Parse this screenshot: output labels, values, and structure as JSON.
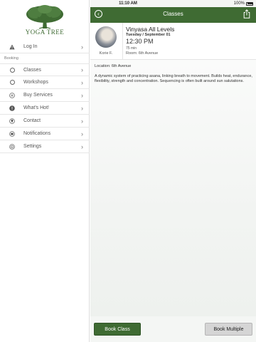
{
  "status_bar": {
    "time": "11:10 AM",
    "battery": "100%"
  },
  "sidebar": {
    "brand": "YOGA TREE",
    "login": {
      "label": "Log In",
      "icon": "warning-icon"
    },
    "section_label": "Booking",
    "items": [
      {
        "label": "Classes",
        "icon": "circle-icon"
      },
      {
        "label": "Workshops",
        "icon": "circle-icon"
      },
      {
        "label": "Buy Services",
        "icon": "plus-circle-icon"
      },
      {
        "label": "What's Hot!",
        "icon": "exclamation-circle-icon"
      },
      {
        "label": "Contact",
        "icon": "location-pin-icon"
      },
      {
        "label": "Notifications",
        "icon": "notification-icon"
      },
      {
        "label": "Settings",
        "icon": "settings-icon"
      }
    ]
  },
  "header": {
    "title": "Classes",
    "accent": "#3f6b33"
  },
  "class": {
    "instructor": "Korie F.",
    "title": "Vinyasa All Levels",
    "date": "Tuesday / September 01",
    "time": "12:30 PM",
    "duration": "75 min",
    "room": "Room: 6th Avenue",
    "location": "Location: 6th Avenue",
    "description": "A dynamic system of practicing asana, linking breath to movement. Builds heat, endurance, flexibility, strength and concentration. Sequencing is often built around sun salutations."
  },
  "buttons": {
    "book": "Book Class",
    "book_multiple": "Book Multiple"
  }
}
